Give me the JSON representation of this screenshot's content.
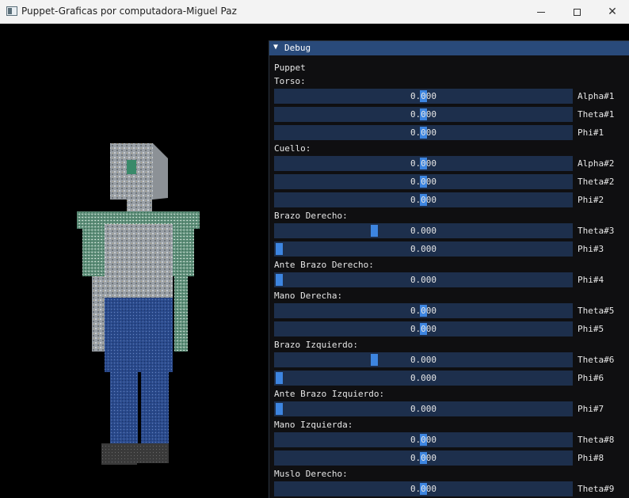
{
  "window": {
    "title": "Puppet-Graficas por computadora-Miguel Paz",
    "minimize_icon": "minimize-icon",
    "maximize_icon": "maximize-icon",
    "close_icon": "close-icon"
  },
  "debug": {
    "title": "Debug",
    "heading": "Puppet",
    "sections": [
      {
        "label": "Torso:",
        "sliders": [
          {
            "name": "Alpha#1",
            "value": "0.000",
            "fraction": 0.5
          },
          {
            "name": "Theta#1",
            "value": "0.000",
            "fraction": 0.5
          },
          {
            "name": "Phi#1",
            "value": "0.000",
            "fraction": 0.5
          }
        ]
      },
      {
        "label": "Cuello:",
        "sliders": [
          {
            "name": "Alpha#2",
            "value": "0.000",
            "fraction": 0.5
          },
          {
            "name": "Theta#2",
            "value": "0.000",
            "fraction": 0.5
          },
          {
            "name": "Phi#2",
            "value": "0.000",
            "fraction": 0.5
          }
        ]
      },
      {
        "label": "Brazo Derecho:",
        "sliders": [
          {
            "name": "Theta#3",
            "value": "0.000",
            "fraction": 0.33
          },
          {
            "name": "Phi#3",
            "value": "0.000",
            "fraction": 0.0
          }
        ]
      },
      {
        "label": "Ante Brazo Derecho:",
        "sliders": [
          {
            "name": "Phi#4",
            "value": "0.000",
            "fraction": 0.0
          }
        ]
      },
      {
        "label": "Mano Derecha:",
        "sliders": [
          {
            "name": "Theta#5",
            "value": "0.000",
            "fraction": 0.5
          },
          {
            "name": "Phi#5",
            "value": "0.000",
            "fraction": 0.5
          }
        ]
      },
      {
        "label": "Brazo Izquierdo:",
        "sliders": [
          {
            "name": "Theta#6",
            "value": "0.000",
            "fraction": 0.33
          },
          {
            "name": "Phi#6",
            "value": "0.000",
            "fraction": 0.0
          }
        ]
      },
      {
        "label": "Ante Brazo Izquierdo:",
        "sliders": [
          {
            "name": "Phi#7",
            "value": "0.000",
            "fraction": 0.0
          }
        ]
      },
      {
        "label": "Mano Izquierda:",
        "sliders": [
          {
            "name": "Theta#8",
            "value": "0.000",
            "fraction": 0.5
          },
          {
            "name": "Phi#8",
            "value": "0.000",
            "fraction": 0.5
          }
        ]
      },
      {
        "label": "Muslo Derecho:",
        "sliders": [
          {
            "name": "Theta#9",
            "value": "0.000",
            "fraction": 0.5
          }
        ]
      }
    ]
  },
  "colors": {
    "panel_bg": "#0f0f11",
    "header": "#294a7a",
    "slider_bg": "#1d2f4c",
    "slider_grab": "#3d85e0"
  }
}
